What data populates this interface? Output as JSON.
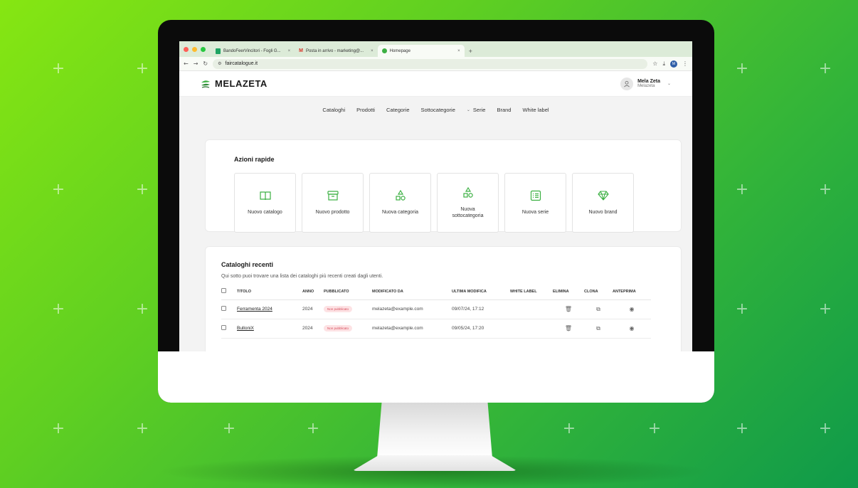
{
  "browser": {
    "tabs": [
      {
        "icon": "sheets-icon",
        "label": "BandoFeerVincitori - Fogli G...",
        "active": false
      },
      {
        "icon": "gmail-icon",
        "label": "Posta in arrivo - marketing@...",
        "active": false
      },
      {
        "icon": "melazeta-favicon",
        "label": "Homepage",
        "active": true
      }
    ],
    "new_tab": "+",
    "url": "faircatalogue.it",
    "profile_initial": "M"
  },
  "app": {
    "brand": "MELAZETA",
    "user": {
      "name": "Mela Zeta",
      "company": "Melazeta"
    },
    "nav": [
      "Cataloghi",
      "Prodotti",
      "Categorie",
      "Sottocategorie",
      "Serie",
      "Brand",
      "White label"
    ]
  },
  "quick_actions": {
    "title": "Azioni rapide",
    "items": [
      {
        "label": "Nuovo catalogo",
        "icon": "book-icon"
      },
      {
        "label": "Nuovo prodotto",
        "icon": "archive-box-icon"
      },
      {
        "label": "Nuova categoria",
        "icon": "shapes-icon"
      },
      {
        "label": "Nuova sottocategoria",
        "icon": "shapes-icon"
      },
      {
        "label": "Nuova serie",
        "icon": "list-icon"
      },
      {
        "label": "Nuovo brand",
        "icon": "diamond-icon"
      }
    ]
  },
  "recent": {
    "title": "Cataloghi recenti",
    "subtitle": "Qui sotto puoi trovare una lista dei cataloghi più recenti creati dagli utenti.",
    "columns": [
      "Titolo",
      "Anno",
      "Pubblicato",
      "Modificato da",
      "Ultima modifica",
      "White label",
      "Elimina",
      "Clona",
      "Anteprima"
    ],
    "rows": [
      {
        "title": "Ferramenta 2024",
        "year": "2024",
        "status": "Non pubblicato",
        "modified_by": "melazeta@example.com",
        "last_modified": "09/07/24, 17:12"
      },
      {
        "title": "BulloniX",
        "year": "2024",
        "status": "Non pubblicato",
        "modified_by": "melazeta@example.com",
        "last_modified": "09/05/24, 17:20"
      }
    ]
  },
  "colors": {
    "accent": "#3cb043",
    "badge_bg": "#fde2e4",
    "badge_text": "#d64b5a"
  }
}
